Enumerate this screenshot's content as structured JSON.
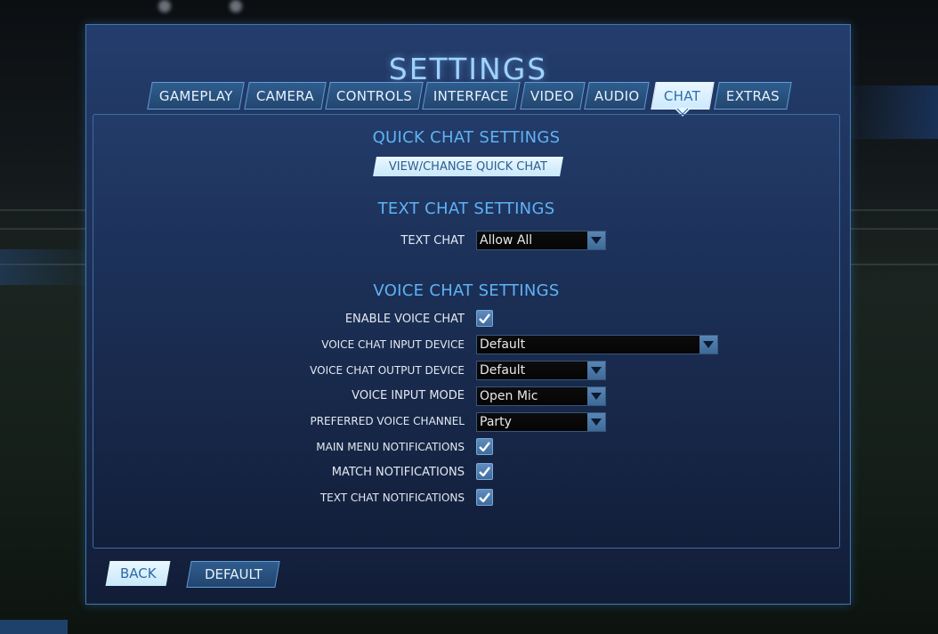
{
  "title": "SETTINGS",
  "tabs": [
    {
      "label": "GAMEPLAY",
      "active": false
    },
    {
      "label": "CAMERA",
      "active": false
    },
    {
      "label": "CONTROLS",
      "active": false
    },
    {
      "label": "INTERFACE",
      "active": false
    },
    {
      "label": "VIDEO",
      "active": false
    },
    {
      "label": "AUDIO",
      "active": false
    },
    {
      "label": "CHAT",
      "active": true
    },
    {
      "label": "EXTRAS",
      "active": false
    }
  ],
  "quick_chat": {
    "heading": "QUICK CHAT SETTINGS",
    "button_label": "VIEW/CHANGE QUICK CHAT"
  },
  "text_chat": {
    "heading": "TEXT CHAT SETTINGS",
    "text_chat_label": "TEXT CHAT",
    "text_chat_value": "Allow All"
  },
  "voice_chat": {
    "heading": "VOICE CHAT SETTINGS",
    "enable_label": "ENABLE VOICE CHAT",
    "enable_checked": true,
    "input_device_label": "VOICE CHAT INPUT DEVICE",
    "input_device_value": "Default",
    "output_device_label": "VOICE CHAT OUTPUT DEVICE",
    "output_device_value": "Default",
    "input_mode_label": "VOICE INPUT MODE",
    "input_mode_value": "Open Mic",
    "channel_label": "PREFERRED VOICE CHANNEL",
    "channel_value": "Party",
    "main_menu_notif_label": "MAIN MENU NOTIFICATIONS",
    "main_menu_notif_checked": true,
    "match_notif_label": "MATCH NOTIFICATIONS",
    "match_notif_checked": true,
    "text_chat_notif_label": "TEXT CHAT NOTIFICATIONS",
    "text_chat_notif_checked": true
  },
  "footer": {
    "back_label": "BACK",
    "default_label": "DEFAULT"
  },
  "icons": {
    "checkmark": "checkmark-icon",
    "dropdown": "chevron-down-icon",
    "tab_pointer": "chevron-down-icon"
  },
  "colors": {
    "accent": "#5fb2f5",
    "title": "#9fd2ff",
    "active_tab": "#e9f7ff"
  }
}
